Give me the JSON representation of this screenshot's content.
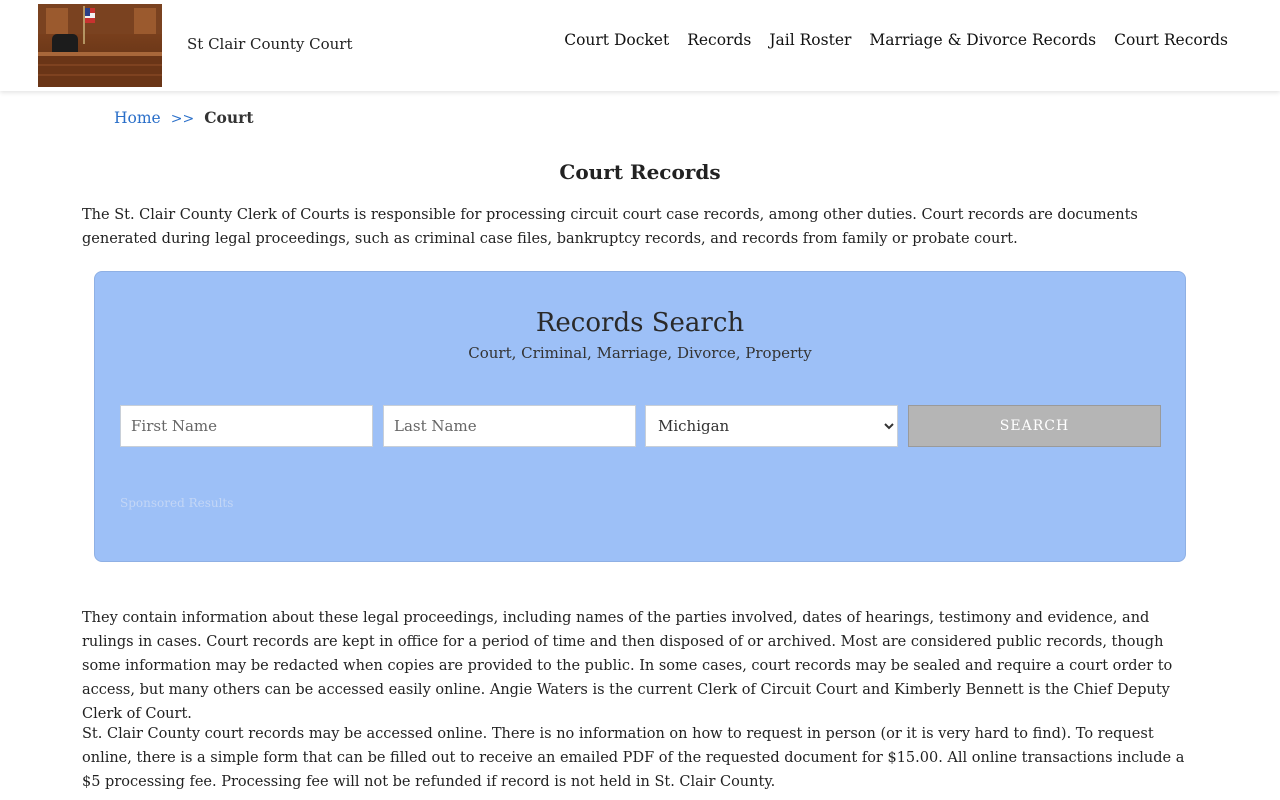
{
  "header": {
    "logo_alt": "courtroom",
    "site_title": "St Clair County Court",
    "nav": [
      {
        "label": "Court Docket"
      },
      {
        "label": "Records"
      },
      {
        "label": "Jail Roster"
      },
      {
        "label": "Marriage & Divorce Records"
      },
      {
        "label": "Court Records"
      }
    ]
  },
  "breadcrumb": {
    "home": "Home",
    "separator": ">>",
    "current": "Court"
  },
  "main": {
    "title": "Court Records",
    "intro": "The St. Clair County Clerk of Courts is responsible for processing circuit court case records, among other duties. Court records are documents generated during legal proceedings, such as criminal case files, bankruptcy records, and records from family or probate court.",
    "body": [
      "They contain information about these legal proceedings, including names of the parties involved, dates of hearings, testimony and evidence, and rulings in cases. Court records are kept in office for a period of time and then disposed of or archived. Most are considered public records, though some information may be redacted when copies are provided to the public. In some cases, court records may be sealed and require a court order to access, but many others can be accessed easily online. Angie Waters is the current Clerk of Circuit Court and Kimberly Bennett is the Chief Deputy Clerk of Court.",
      "St. Clair County court records may be accessed online. There is no information on how to request in person (or it is very hard to find). To request online, there is a simple form that can be filled out to receive an emailed PDF of the requested document for $15.00. All online transactions include a $5 processing fee. Processing fee will not be refunded if record is not held in St. Clair County."
    ]
  },
  "search": {
    "title": "Records Search",
    "subtitle": "Court, Criminal, Marriage, Divorce, Property",
    "first_name_placeholder": "First Name",
    "last_name_placeholder": "Last Name",
    "state_selected": "Michigan",
    "button_label": "SEARCH",
    "sponsored": "Sponsored Results"
  },
  "colors": {
    "search_bg": "#9dc0f7",
    "link": "#2a6fc9",
    "button_bg": "#b5b5b5"
  }
}
